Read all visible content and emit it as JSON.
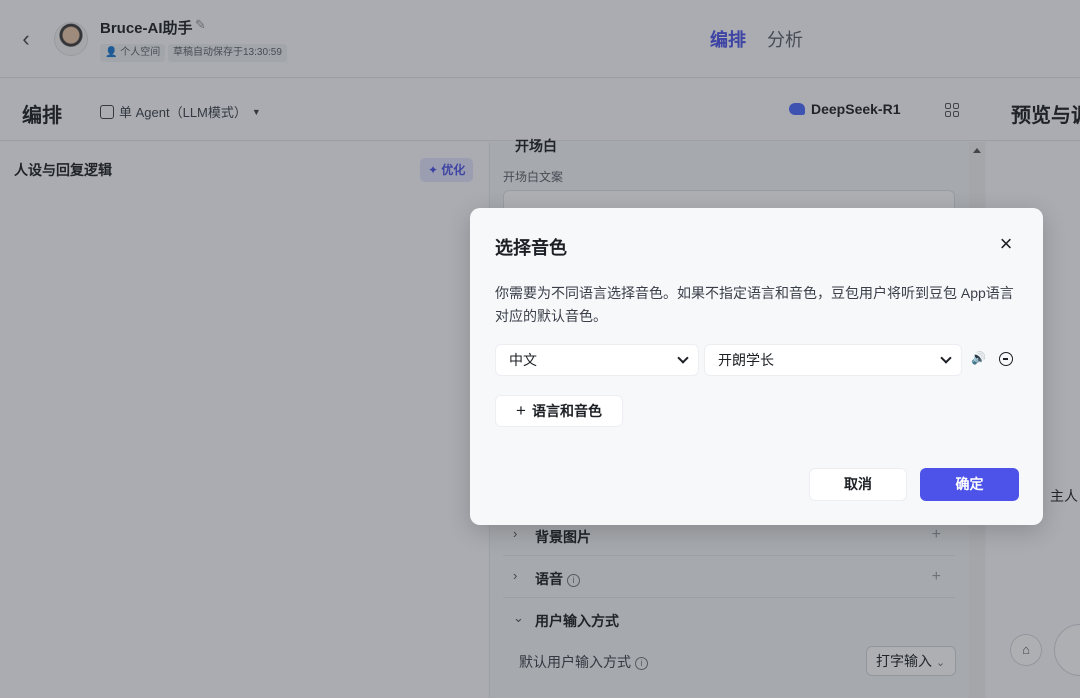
{
  "header": {
    "bot_name": "Bruce-AI助手",
    "space_label": "个人空间",
    "autosave": "草稿自动保存于13:30:59",
    "tabs": [
      {
        "label": "编排",
        "active": true
      },
      {
        "label": "分析",
        "active": false
      }
    ]
  },
  "toolbar": {
    "title": "编排",
    "mode": "单 Agent（LLM模式）",
    "model": "DeepSeek-R1",
    "preview_title": "预览与调"
  },
  "left": {
    "persona_title": "人设与回复逻辑",
    "optimize_label": "优化"
  },
  "middle": {
    "opening_section": "开场白",
    "opening_label": "开场白文案",
    "sections": [
      {
        "label": "背景图片",
        "expanded": false
      },
      {
        "label": "语音",
        "expanded": false
      },
      {
        "label": "用户输入方式",
        "expanded": true
      }
    ],
    "default_input_label": "默认用户输入方式",
    "default_input_value": "打字输入"
  },
  "right": {
    "chat_snippet": "，主人"
  },
  "dialog": {
    "title": "选择音色",
    "description": "你需要为不同语言选择音色。如果不指定语言和音色，豆包用户将听到豆包 App语言对应的默认音色。",
    "language": "中文",
    "voice": "开朗学长",
    "add_label": "语言和音色",
    "cancel_label": "取消",
    "confirm_label": "确定"
  },
  "colors": {
    "accent": "#4d53e8",
    "overlay": "rgba(40,44,52,0.38)"
  }
}
